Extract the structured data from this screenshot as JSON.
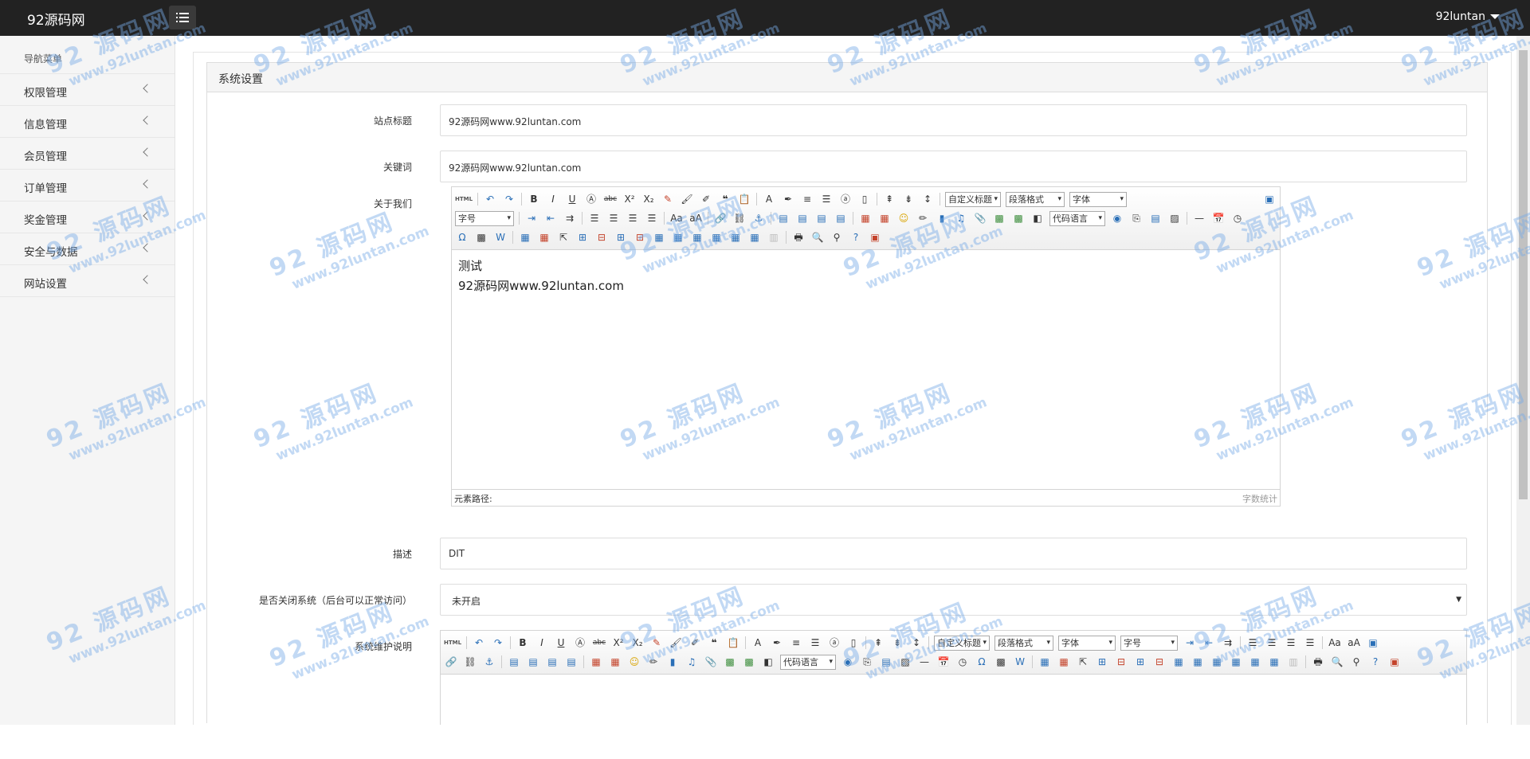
{
  "header": {
    "brand": "92源码网",
    "user": "92luntan"
  },
  "sidebar": {
    "title": "导航菜单",
    "items": [
      {
        "label": "权限管理"
      },
      {
        "label": "信息管理"
      },
      {
        "label": "会员管理"
      },
      {
        "label": "订单管理"
      },
      {
        "label": "奖金管理"
      },
      {
        "label": "安全与数据"
      },
      {
        "label": "网站设置"
      }
    ]
  },
  "panel": {
    "title": "系统设置"
  },
  "form": {
    "site_title": {
      "label": "站点标题",
      "value": "92源码网www.92luntan.com"
    },
    "keywords": {
      "label": "关键词",
      "value": "92源码网www.92luntan.com"
    },
    "about": {
      "label": "关于我们",
      "content_line1": "测试",
      "content_line2": "92源码网www.92luntan.com",
      "status_path": "元素路径:",
      "word_count": "字数统计"
    },
    "description": {
      "label": "描述",
      "value": "DIT"
    },
    "close_system": {
      "label": "是否关闭系统（后台可以正常访问）",
      "value": "未开启"
    },
    "maintenance": {
      "label": "系统维护说明"
    }
  },
  "editor_toolbar": {
    "html": "HTML",
    "custom_title": "自定义标题",
    "paragraph": "段落格式",
    "font_family": "字体",
    "font_size": "字号",
    "code_lang": "代码语言"
  },
  "watermark": {
    "line1": "92 源码网",
    "line2": "www.92luntan.com"
  }
}
